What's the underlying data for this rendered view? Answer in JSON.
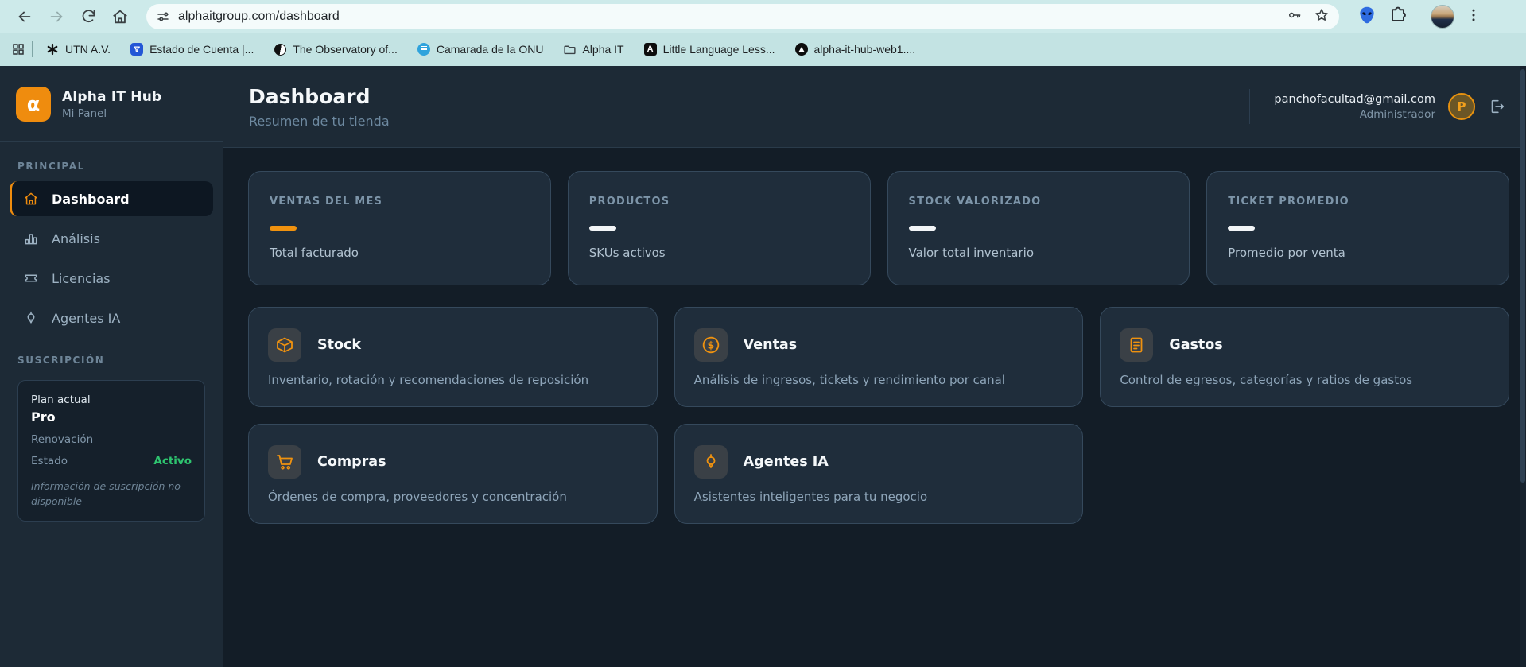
{
  "browser": {
    "url": "alphaitgroup.com/dashboard",
    "bookmarks": [
      {
        "label": "UTN A.V."
      },
      {
        "label": "Estado de Cuenta |..."
      },
      {
        "label": "The Observatory of..."
      },
      {
        "label": "Camarada de la ONU"
      },
      {
        "label": "Alpha IT"
      },
      {
        "label": "Little Language Less..."
      },
      {
        "label": "alpha-it-hub-web1...."
      }
    ]
  },
  "sidebar": {
    "app_name": "Alpha IT Hub",
    "app_subtitle": "Mi Panel",
    "logo_letter": "α",
    "section_principal": "PRINCIPAL",
    "items": [
      {
        "label": "Dashboard"
      },
      {
        "label": "Análisis"
      },
      {
        "label": "Licencias"
      },
      {
        "label": "Agentes IA"
      }
    ],
    "section_subscription": "SUSCRIPCIÓN",
    "subscription": {
      "plan_label": "Plan actual",
      "plan_name": "Pro",
      "renewal_label": "Renovación",
      "renewal_value": "—",
      "status_label": "Estado",
      "status_value": "Activo",
      "note": "Información de suscripción no disponible"
    }
  },
  "header": {
    "title": "Dashboard",
    "subtitle": "Resumen de tu tienda",
    "user_email": "panchofacultad@gmail.com",
    "user_role": "Administrador",
    "avatar_letter": "P"
  },
  "stats": [
    {
      "label": "VENTAS DEL MES",
      "sublabel": "Total facturado",
      "accent": "#f0920f"
    },
    {
      "label": "PRODUCTOS",
      "sublabel": "SKUs activos",
      "accent": "#f2f5f7"
    },
    {
      "label": "STOCK VALORIZADO",
      "sublabel": "Valor total inventario",
      "accent": "#f2f5f7"
    },
    {
      "label": "TICKET PROMEDIO",
      "sublabel": "Promedio por venta",
      "accent": "#f2f5f7"
    }
  ],
  "modules": [
    {
      "title": "Stock",
      "description": "Inventario, rotación y recomendaciones de reposición"
    },
    {
      "title": "Ventas",
      "description": "Análisis de ingresos, tickets y rendimiento por canal"
    },
    {
      "title": "Gastos",
      "description": "Control de egresos, categorías y ratios de gastos"
    },
    {
      "title": "Compras",
      "description": "Órdenes de compra, proveedores y concentración"
    },
    {
      "title": "Agentes IA",
      "description": "Asistentes inteligentes para tu negocio"
    }
  ],
  "colors": {
    "accent_orange": "#ef8c0e",
    "status_green": "#2ec46f",
    "sidebar_bg": "#1d2a36",
    "content_bg": "#131d27",
    "card_bg": "#1f2d3b",
    "browser_bar": "#cdeaea"
  },
  "misc": {
    "dollar_glyph": "$"
  }
}
